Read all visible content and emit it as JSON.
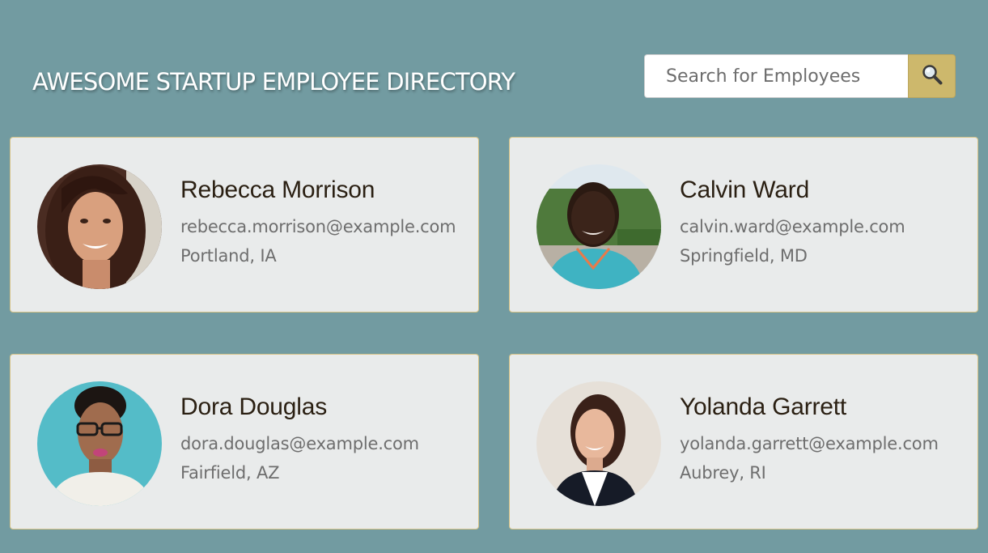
{
  "header": {
    "title": "AWESOME STARTUP EMPLOYEE DIRECTORY",
    "search_placeholder": "Search for Employees",
    "search_icon": "magnifier-icon"
  },
  "colors": {
    "background": "#729ba1",
    "card_background": "#e9ebeb",
    "card_border": "#d3c185",
    "search_button": "#cdb86c",
    "name_text": "#2a1f12",
    "detail_text": "#6e6e6e"
  },
  "employees": [
    {
      "name": "Rebecca Morrison",
      "email": "rebecca.morrison@example.com",
      "location": "Portland, IA"
    },
    {
      "name": "Calvin Ward",
      "email": "calvin.ward@example.com",
      "location": "Springfield, MD"
    },
    {
      "name": "Dora Douglas",
      "email": "dora.douglas@example.com",
      "location": "Fairfield, AZ"
    },
    {
      "name": "Yolanda Garrett",
      "email": "yolanda.garrett@example.com",
      "location": "Aubrey, RI"
    }
  ]
}
